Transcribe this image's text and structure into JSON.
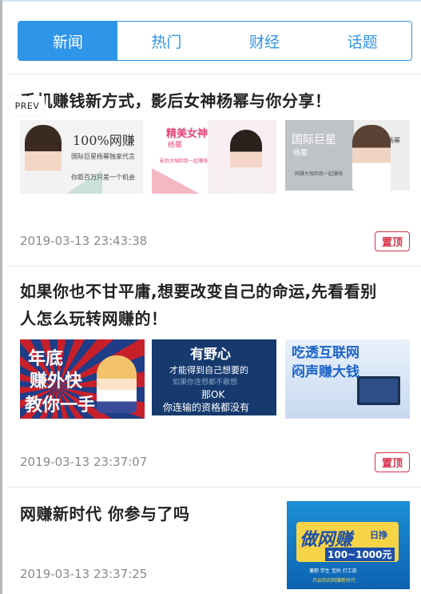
{
  "tabs": [
    {
      "label": "新闻",
      "active": true
    },
    {
      "label": "热门",
      "active": false
    },
    {
      "label": "财经",
      "active": false
    },
    {
      "label": "话题",
      "active": false
    }
  ],
  "prev_label": "PREV",
  "articles": [
    {
      "title": "手机赚钱新方式，影后女神杨幂与你分享！",
      "date": "2019-03-13 23:43:38",
      "badge": "置顶",
      "thumbs": [
        {
          "line1": "100%网赚",
          "line2": "国际巨星杨幂独家代言",
          "line3": "你距百万只差一个机会"
        },
        {
          "line1": "精美女神",
          "line2": "杨幂",
          "line3": "影后大咖和我一起赚钱"
        },
        {
          "line1": "国际巨星",
          "line2": "杨幂",
          "line3": "杨幂",
          "line4": "网赚大咖和我一起赚钱"
        }
      ]
    },
    {
      "title_line1": "如果你也不甘平庸,想要改变自己的命运,先看看别",
      "title_line2": "人怎么玩转网赚的！",
      "date": "2019-03-13 23:37:07",
      "badge": "置顶",
      "thumbs": [
        {
          "line1": "年底",
          "line2": "赚外快",
          "line3": "教你一手"
        },
        {
          "line1": "有野心",
          "line2": "才能得到自己想要的",
          "line3": "如果你连想都不敢想",
          "line4": "那OK",
          "line5": "你连输的资格都没有"
        },
        {
          "line1": "吃透互联网",
          "line2": "闷声赚大钱"
        }
      ]
    },
    {
      "title": "网赚新时代 你参与了吗",
      "date": "2019-03-13 23:37:25",
      "thumbs": [
        {
          "line1": "做网赚",
          "line2": "日挣",
          "line3": "100~1000元",
          "line4": "兼职 学生 宝妈 打工族",
          "line5": "开启你的网赚新时代"
        }
      ]
    }
  ],
  "colors": {
    "accent": "#2f95e8",
    "badge": "#d6334a",
    "date": "#8a8a8a"
  }
}
